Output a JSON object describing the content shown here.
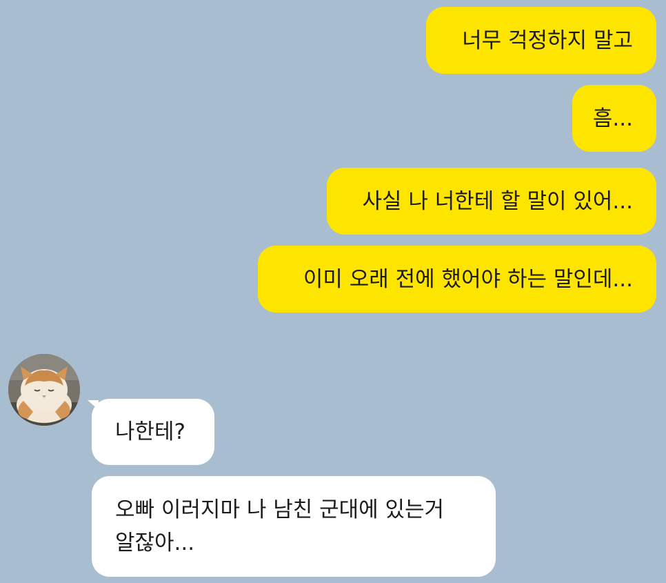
{
  "chat": {
    "messages": [
      {
        "sender": "me",
        "text": "너무 걱정하지 말고"
      },
      {
        "sender": "me",
        "text": "흠..."
      },
      {
        "sender": "me",
        "text": "사실 나 너한테 할 말이 있어..."
      },
      {
        "sender": "me",
        "text": "이미 오래 전에 했어야 하는 말인데..."
      },
      {
        "sender": "other",
        "text": "나한테?"
      },
      {
        "sender": "other",
        "text": "오빠 이러지마 나 남친 군대에 있는거\n알잖아..."
      }
    ]
  },
  "profile": {
    "avatar": "cat-photo"
  },
  "colors": {
    "background": "#a9bdd1",
    "outgoing_bubble": "#fee500",
    "incoming_bubble": "#ffffff"
  }
}
